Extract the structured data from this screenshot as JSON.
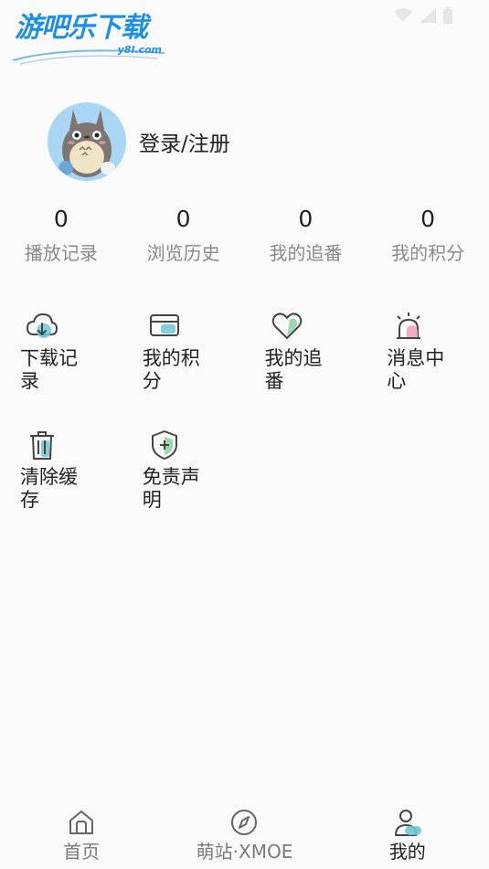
{
  "status_bar": {
    "icons": [
      "wifi-icon",
      "signal-icon",
      "battery-icon"
    ]
  },
  "watermark": {
    "title": "游吧乐下载",
    "subtitle": "y8l.com"
  },
  "profile": {
    "login_label": "登录/注册"
  },
  "stats": [
    {
      "value": "0",
      "label": "播放记录"
    },
    {
      "value": "0",
      "label": "浏览历史"
    },
    {
      "value": "0",
      "label": "我的追番"
    },
    {
      "value": "0",
      "label": "我的积分"
    }
  ],
  "features": [
    {
      "label": "下载记录",
      "icon": "cloud-download-icon"
    },
    {
      "label": "我的积分",
      "icon": "card-icon"
    },
    {
      "label": "我的追番",
      "icon": "heart-icon"
    },
    {
      "label": "消息中心",
      "icon": "alarm-light-icon"
    },
    {
      "label": "清除缓存",
      "icon": "trash-icon"
    },
    {
      "label": "免责声明",
      "icon": "shield-plus-icon"
    }
  ],
  "bottom_nav": [
    {
      "label": "首页",
      "icon": "home-icon",
      "active": false
    },
    {
      "label": "萌站·XMOE",
      "icon": "compass-icon",
      "active": false
    },
    {
      "label": "我的",
      "icon": "user-icon",
      "active": true
    }
  ],
  "colors": {
    "background": "#fafafa",
    "accent_teal": "#6cc7d6",
    "accent_green": "#8fd3a6",
    "accent_pink": "#f5a3b5",
    "watermark_blue": "#1e8fe6",
    "label_gray": "#8a8a8a"
  }
}
